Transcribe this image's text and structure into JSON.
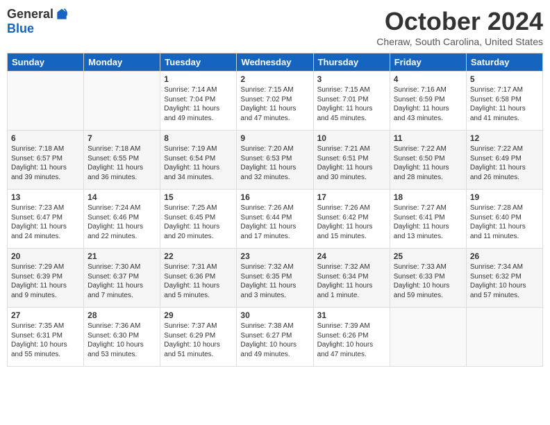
{
  "logo": {
    "general": "General",
    "blue": "Blue"
  },
  "title": {
    "month": "October 2024",
    "location": "Cheraw, South Carolina, United States"
  },
  "headers": [
    "Sunday",
    "Monday",
    "Tuesday",
    "Wednesday",
    "Thursday",
    "Friday",
    "Saturday"
  ],
  "weeks": [
    [
      {
        "day": "",
        "info": ""
      },
      {
        "day": "",
        "info": ""
      },
      {
        "day": "1",
        "info": "Sunrise: 7:14 AM\nSunset: 7:04 PM\nDaylight: 11 hours and 49 minutes."
      },
      {
        "day": "2",
        "info": "Sunrise: 7:15 AM\nSunset: 7:02 PM\nDaylight: 11 hours and 47 minutes."
      },
      {
        "day": "3",
        "info": "Sunrise: 7:15 AM\nSunset: 7:01 PM\nDaylight: 11 hours and 45 minutes."
      },
      {
        "day": "4",
        "info": "Sunrise: 7:16 AM\nSunset: 6:59 PM\nDaylight: 11 hours and 43 minutes."
      },
      {
        "day": "5",
        "info": "Sunrise: 7:17 AM\nSunset: 6:58 PM\nDaylight: 11 hours and 41 minutes."
      }
    ],
    [
      {
        "day": "6",
        "info": "Sunrise: 7:18 AM\nSunset: 6:57 PM\nDaylight: 11 hours and 39 minutes."
      },
      {
        "day": "7",
        "info": "Sunrise: 7:18 AM\nSunset: 6:55 PM\nDaylight: 11 hours and 36 minutes."
      },
      {
        "day": "8",
        "info": "Sunrise: 7:19 AM\nSunset: 6:54 PM\nDaylight: 11 hours and 34 minutes."
      },
      {
        "day": "9",
        "info": "Sunrise: 7:20 AM\nSunset: 6:53 PM\nDaylight: 11 hours and 32 minutes."
      },
      {
        "day": "10",
        "info": "Sunrise: 7:21 AM\nSunset: 6:51 PM\nDaylight: 11 hours and 30 minutes."
      },
      {
        "day": "11",
        "info": "Sunrise: 7:22 AM\nSunset: 6:50 PM\nDaylight: 11 hours and 28 minutes."
      },
      {
        "day": "12",
        "info": "Sunrise: 7:22 AM\nSunset: 6:49 PM\nDaylight: 11 hours and 26 minutes."
      }
    ],
    [
      {
        "day": "13",
        "info": "Sunrise: 7:23 AM\nSunset: 6:47 PM\nDaylight: 11 hours and 24 minutes."
      },
      {
        "day": "14",
        "info": "Sunrise: 7:24 AM\nSunset: 6:46 PM\nDaylight: 11 hours and 22 minutes."
      },
      {
        "day": "15",
        "info": "Sunrise: 7:25 AM\nSunset: 6:45 PM\nDaylight: 11 hours and 20 minutes."
      },
      {
        "day": "16",
        "info": "Sunrise: 7:26 AM\nSunset: 6:44 PM\nDaylight: 11 hours and 17 minutes."
      },
      {
        "day": "17",
        "info": "Sunrise: 7:26 AM\nSunset: 6:42 PM\nDaylight: 11 hours and 15 minutes."
      },
      {
        "day": "18",
        "info": "Sunrise: 7:27 AM\nSunset: 6:41 PM\nDaylight: 11 hours and 13 minutes."
      },
      {
        "day": "19",
        "info": "Sunrise: 7:28 AM\nSunset: 6:40 PM\nDaylight: 11 hours and 11 minutes."
      }
    ],
    [
      {
        "day": "20",
        "info": "Sunrise: 7:29 AM\nSunset: 6:39 PM\nDaylight: 11 hours and 9 minutes."
      },
      {
        "day": "21",
        "info": "Sunrise: 7:30 AM\nSunset: 6:37 PM\nDaylight: 11 hours and 7 minutes."
      },
      {
        "day": "22",
        "info": "Sunrise: 7:31 AM\nSunset: 6:36 PM\nDaylight: 11 hours and 5 minutes."
      },
      {
        "day": "23",
        "info": "Sunrise: 7:32 AM\nSunset: 6:35 PM\nDaylight: 11 hours and 3 minutes."
      },
      {
        "day": "24",
        "info": "Sunrise: 7:32 AM\nSunset: 6:34 PM\nDaylight: 11 hours and 1 minute."
      },
      {
        "day": "25",
        "info": "Sunrise: 7:33 AM\nSunset: 6:33 PM\nDaylight: 10 hours and 59 minutes."
      },
      {
        "day": "26",
        "info": "Sunrise: 7:34 AM\nSunset: 6:32 PM\nDaylight: 10 hours and 57 minutes."
      }
    ],
    [
      {
        "day": "27",
        "info": "Sunrise: 7:35 AM\nSunset: 6:31 PM\nDaylight: 10 hours and 55 minutes."
      },
      {
        "day": "28",
        "info": "Sunrise: 7:36 AM\nSunset: 6:30 PM\nDaylight: 10 hours and 53 minutes."
      },
      {
        "day": "29",
        "info": "Sunrise: 7:37 AM\nSunset: 6:29 PM\nDaylight: 10 hours and 51 minutes."
      },
      {
        "day": "30",
        "info": "Sunrise: 7:38 AM\nSunset: 6:27 PM\nDaylight: 10 hours and 49 minutes."
      },
      {
        "day": "31",
        "info": "Sunrise: 7:39 AM\nSunset: 6:26 PM\nDaylight: 10 hours and 47 minutes."
      },
      {
        "day": "",
        "info": ""
      },
      {
        "day": "",
        "info": ""
      }
    ]
  ]
}
